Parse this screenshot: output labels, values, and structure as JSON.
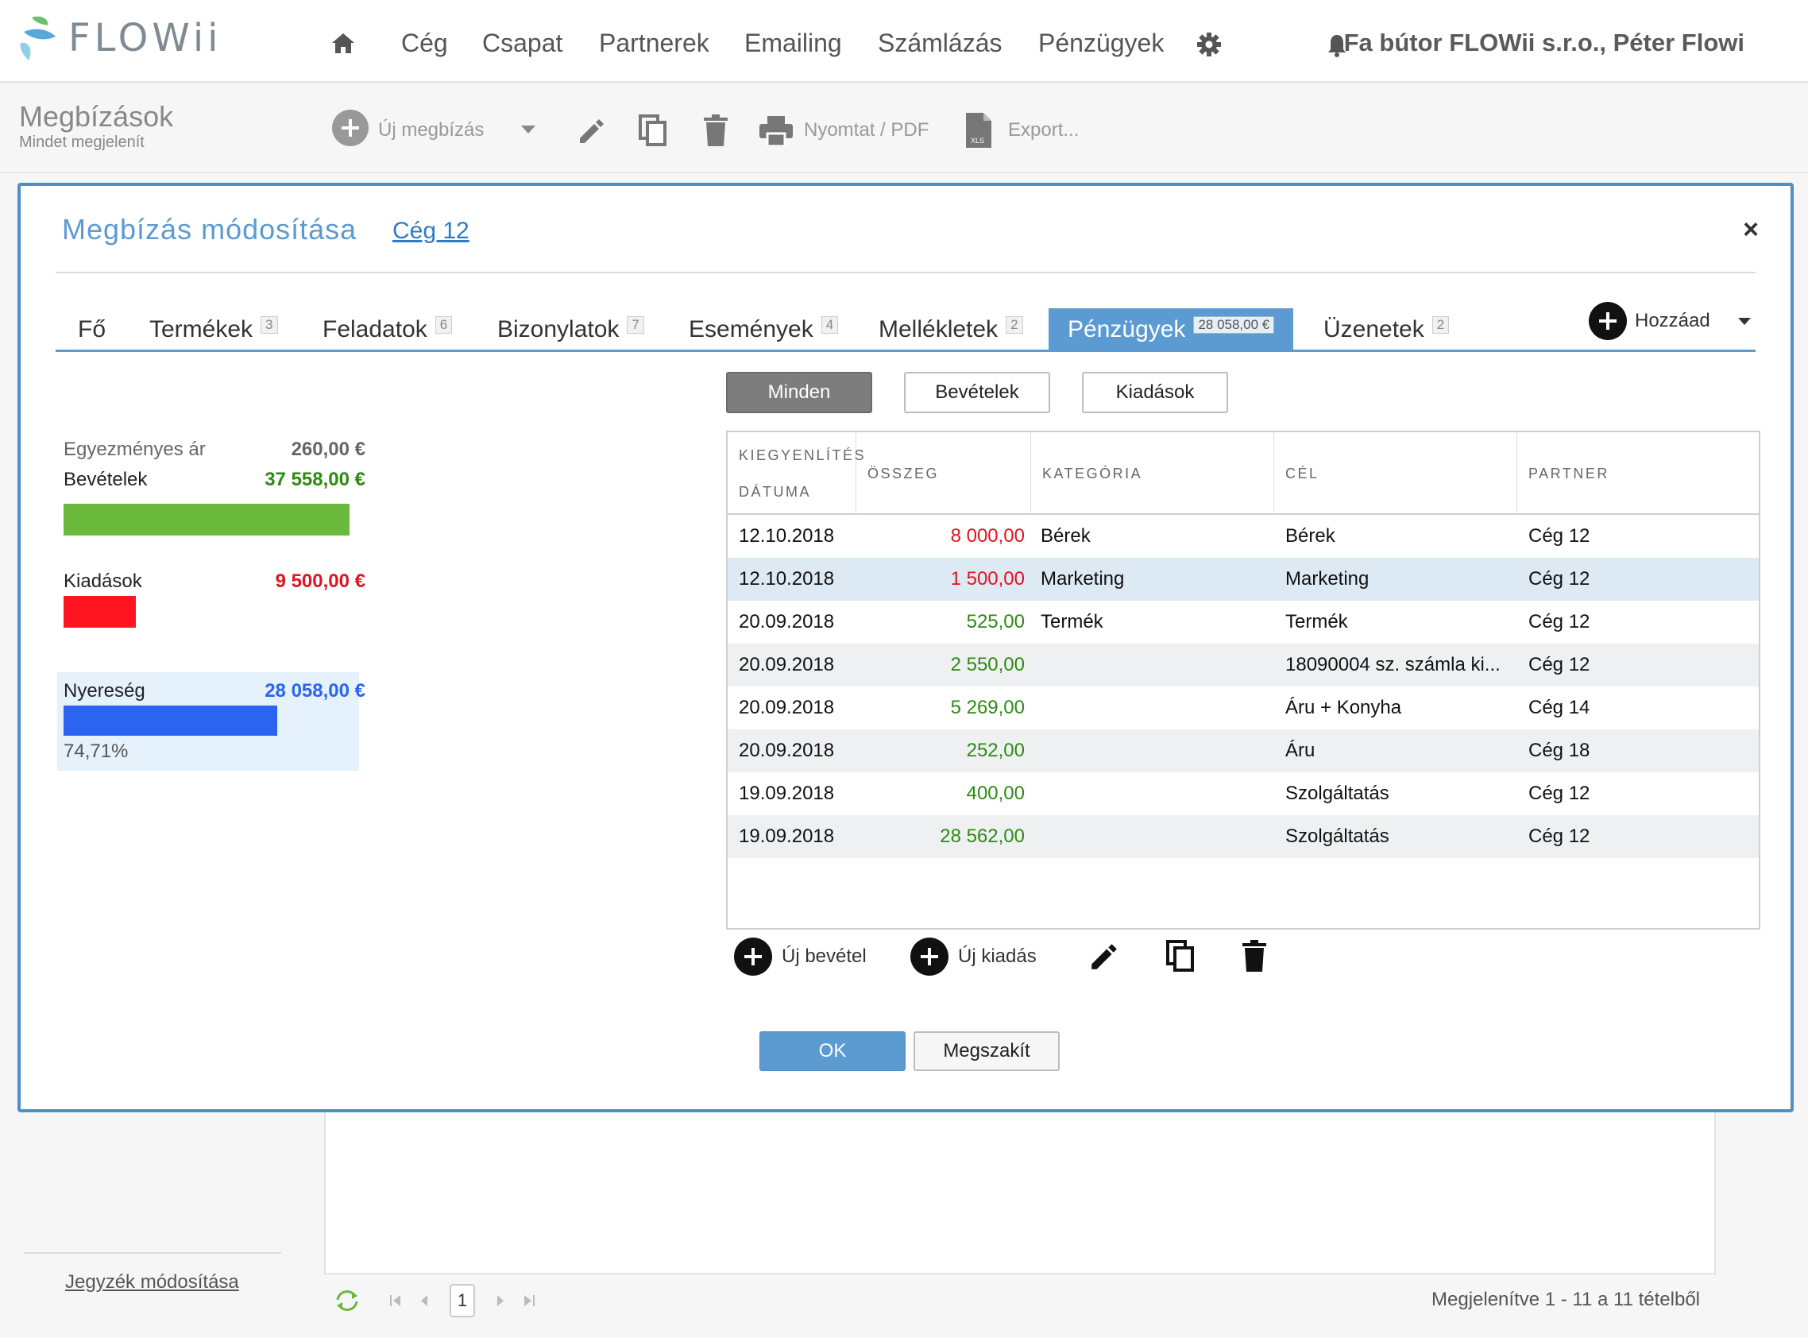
{
  "app": {
    "name": "FLOWii"
  },
  "nav": {
    "items": [
      "Cég",
      "Csapat",
      "Partnerek",
      "Emailing",
      "Számlázás",
      "Pénzügyek"
    ],
    "company_user": "Fa bútor FLOWii s.r.o., Péter Flowi"
  },
  "page": {
    "title": "Megbízások",
    "subtitle": "Mindet megjelenít"
  },
  "toolbar": {
    "new_label": "Új megbízás",
    "print_label": "Nyomtat / PDF",
    "export_label": "Export..."
  },
  "modal": {
    "title": "Megbízás módosítása",
    "link": "Cég 12",
    "close": "×",
    "tabs": [
      {
        "label": "Fő",
        "count": ""
      },
      {
        "label": "Termékek",
        "count": "3"
      },
      {
        "label": "Feladatok",
        "count": "6"
      },
      {
        "label": "Bizonylatok",
        "count": "7"
      },
      {
        "label": "Események",
        "count": "4"
      },
      {
        "label": "Mellékletek",
        "count": "2"
      },
      {
        "label": "Pénzügyek",
        "count": "28 058,00 €"
      },
      {
        "label": "Üzenetek",
        "count": "2"
      }
    ],
    "add_label": "Hozzáad",
    "filters": [
      "Minden",
      "Bevételek",
      "Kiadások"
    ],
    "summary": {
      "agreed_label": "Egyezményes ár",
      "agreed_value": "260,00 €",
      "income_label": "Bevételek",
      "income_value": "37 558,00 €",
      "expense_label": "Kiadások",
      "expense_value": "9 500,00 €",
      "profit_label": "Nyereség",
      "profit_value": "28 058,00 €",
      "profit_percent": "74,71%",
      "expense_fraction_of_income": 0.253,
      "profit_fraction_of_income": 0.747
    },
    "table": {
      "headers": [
        "KIEGYENLÍTÉS DÁTUMA",
        "ÖSSZEG",
        "KATEGÓRIA",
        "CÉL",
        "PARTNER"
      ],
      "rows": [
        {
          "date": "12.10.2018",
          "amount": "8 000,00",
          "type": "expense",
          "category": "Bérek",
          "goal": "Bérek",
          "partner": "Cég 12"
        },
        {
          "date": "12.10.2018",
          "amount": "1 500,00",
          "type": "expense",
          "category": "Marketing",
          "goal": "Marketing",
          "partner": "Cég 12"
        },
        {
          "date": "20.09.2018",
          "amount": "525,00",
          "type": "income",
          "category": "Termék",
          "goal": "Termék",
          "partner": "Cég 12"
        },
        {
          "date": "20.09.2018",
          "amount": "2 550,00",
          "type": "income",
          "category": "",
          "goal": "18090004 sz. számla ki...",
          "partner": "Cég 12"
        },
        {
          "date": "20.09.2018",
          "amount": "5 269,00",
          "type": "income",
          "category": "",
          "goal": "Áru + Konyha",
          "partner": "Cég 14"
        },
        {
          "date": "20.09.2018",
          "amount": "252,00",
          "type": "income",
          "category": "",
          "goal": "Áru",
          "partner": "Cég 18"
        },
        {
          "date": "19.09.2018",
          "amount": "400,00",
          "type": "income",
          "category": "",
          "goal": "Szolgáltatás",
          "partner": "Cég 12"
        },
        {
          "date": "19.09.2018",
          "amount": "28 562,00",
          "type": "income",
          "category": "",
          "goal": "Szolgáltatás",
          "partner": "Cég 12"
        }
      ]
    },
    "actions": {
      "new_income": "Új bevétel",
      "new_expense": "Új kiadás"
    },
    "ok_label": "OK",
    "cancel_label": "Megszakít"
  },
  "footer": {
    "edit_list_link": "Jegyzék módosítása",
    "page_number": "1",
    "record_info": "Megjelenítve 1 - 11 a 11 tételből"
  },
  "colors": {
    "accent": "#5b9bd1",
    "income": "#2e8b12",
    "expense": "#e0141e",
    "profit": "#2b64f0",
    "income_bar": "#6ab83c"
  }
}
